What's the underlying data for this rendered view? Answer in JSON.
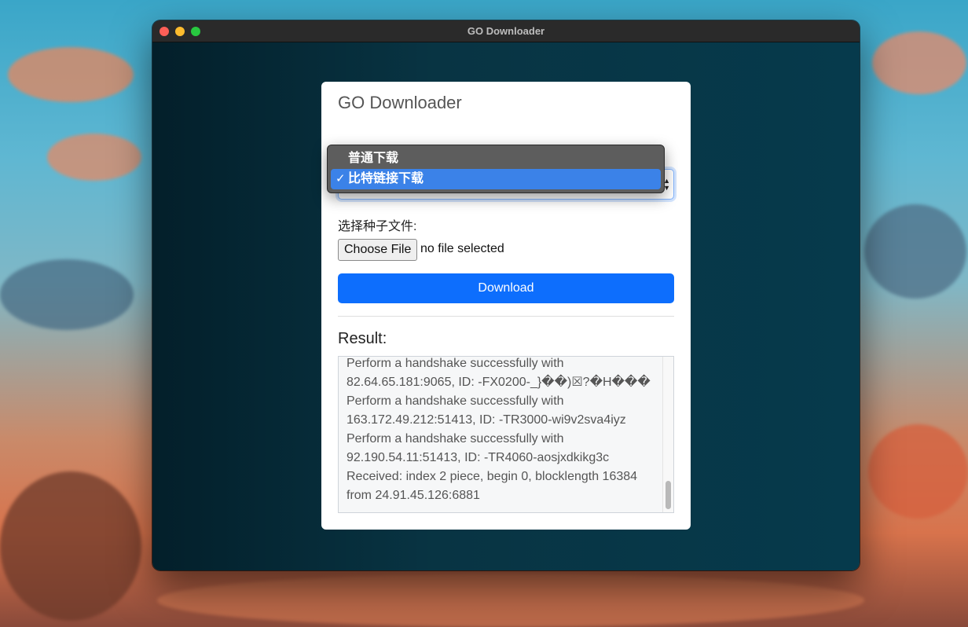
{
  "window": {
    "title": "GO Downloader"
  },
  "app": {
    "heading": "GO Downloader",
    "mode_options": [
      "普通下载",
      "比特链接下载"
    ],
    "selected_option_index": 1,
    "check_mark": "✓",
    "seed_label": "选择种子文件:",
    "choose_file_label": "Choose File",
    "file_status": "no file selected",
    "download_label": "Download",
    "result_label": "Result:",
    "result_text": "Perform a handshake successfully with 82.64.65.181:9065, ID: -FX0200-_}��)☒?�H��� Perform a handshake successfully with 163.172.49.212:51413, ID: -TR3000-wi9v2sva4iyz Perform a handshake successfully with 92.190.54.11:51413, ID: -TR4060-aosjxdkikg3c Received: index 2 piece, begin 0, blocklength 16384 from 24.91.45.126:6881"
  },
  "colors": {
    "accent": "#0d6efd",
    "menu_highlight": "#3b82e8",
    "menu_bg": "#5d5d5d"
  }
}
